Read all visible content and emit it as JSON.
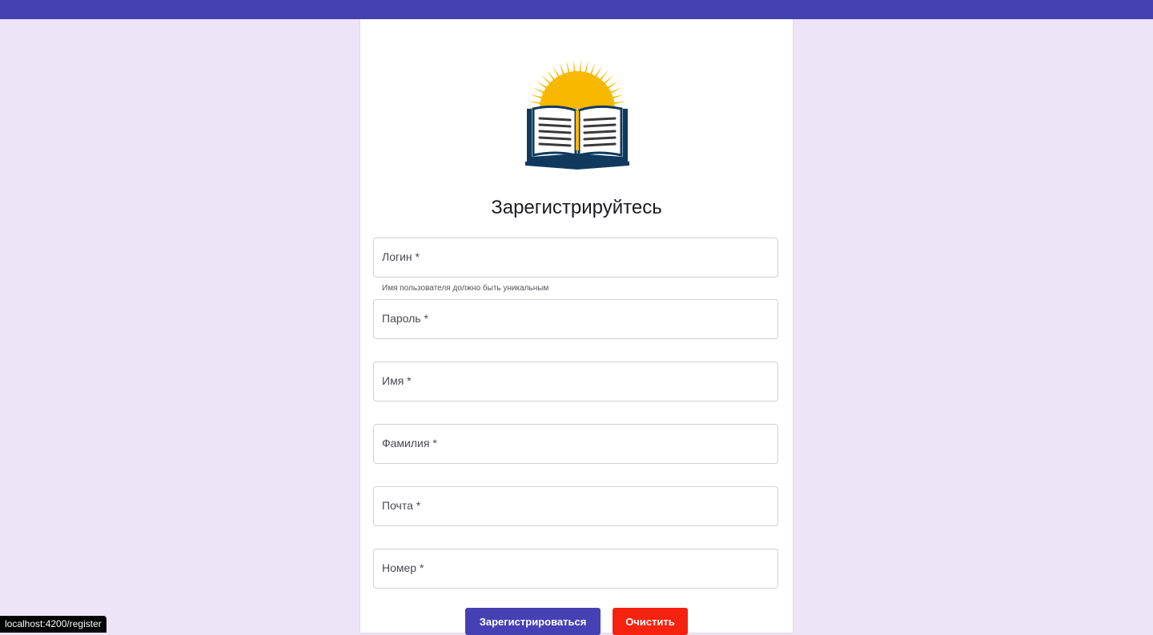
{
  "colors": {
    "primary": "#4541b5",
    "danger": "#f5220f",
    "background": "#ede4f7",
    "logo_sun": "#f9b800",
    "logo_book": "#11395e"
  },
  "logo": {
    "icon": "open-book-sun-icon"
  },
  "form": {
    "title": "Зарегистрируйтесь",
    "fields": {
      "login": {
        "label": "Логин *",
        "value": ""
      },
      "password": {
        "label": "Пароль *",
        "value": ""
      },
      "firstname": {
        "label": "Имя *",
        "value": ""
      },
      "lastname": {
        "label": "Фамилия *",
        "value": ""
      },
      "email": {
        "label": "Почта *",
        "value": ""
      },
      "phone": {
        "label": "Номер *",
        "value": ""
      }
    },
    "login_hint": "Имя пользователя должно быть уникальным",
    "submit_label": "Зарегистрироваться",
    "clear_label": "Очистить"
  },
  "statusbar": {
    "url": "localhost:4200/register"
  }
}
